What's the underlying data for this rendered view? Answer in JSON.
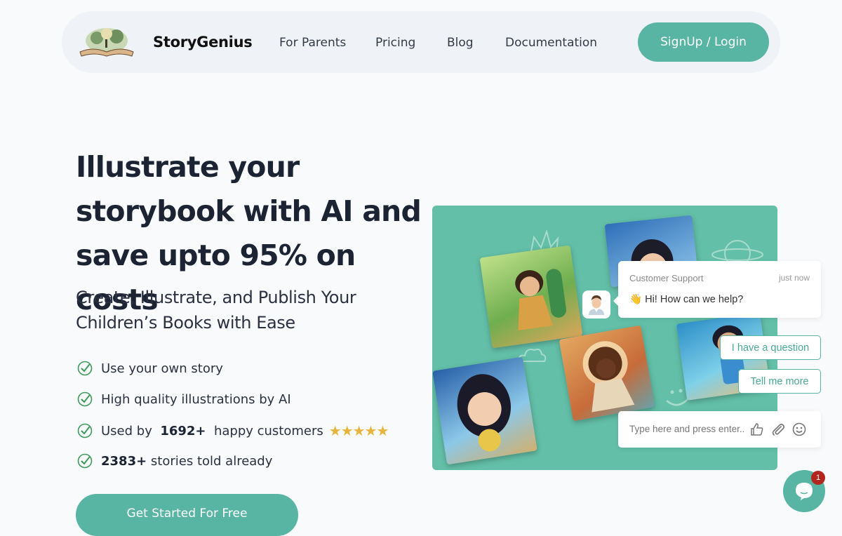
{
  "nav": {
    "brand": "StoryGenius",
    "links": [
      "For Parents",
      "Pricing",
      "Blog",
      "Documentation"
    ],
    "signup_label": "SignUp / Login"
  },
  "hero": {
    "title": "Illustrate your storybook with AI and save upto 95% on costs",
    "subtitle": "Create, Illustrate, and Publish Your Children’s Books with Ease",
    "features": [
      {
        "text": "Use your own story"
      },
      {
        "text": "High quality illustrations by AI"
      },
      {
        "prefix": "Used by",
        "bold": "1692+",
        "suffix": "happy customers",
        "rating": 5,
        "stars": "★★★★★"
      },
      {
        "bold": "2383+",
        "suffix": "stories told already"
      }
    ],
    "cta_label": "Get Started For Free"
  },
  "chat": {
    "agent_name": "Customer Support",
    "time": "just now",
    "message_emoji": "👋",
    "message": "Hi! How can we help?",
    "quick_replies": [
      "I have a question",
      "Tell me more"
    ],
    "input_placeholder": "Type here and press enter..",
    "unread_count": "1"
  },
  "colors": {
    "accent": "#58b4a3",
    "panel": "#63bfa7",
    "stars": "#e8b53c",
    "badge": "#b3261e"
  }
}
